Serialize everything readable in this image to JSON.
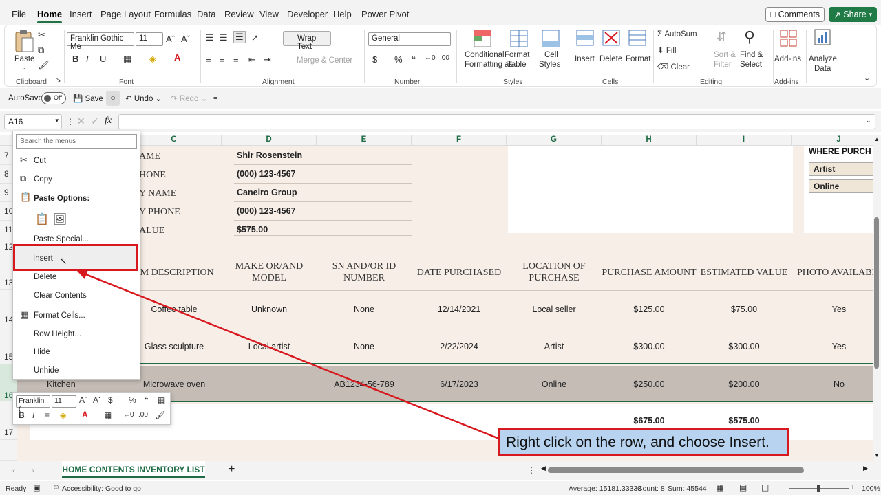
{
  "menu": {
    "tabs": [
      "File",
      "Home",
      "Insert",
      "Page Layout",
      "Formulas",
      "Data",
      "Review",
      "View",
      "Developer",
      "Help",
      "Power Pivot"
    ],
    "comments": "Comments",
    "share": "Share"
  },
  "ribbon": {
    "clipboard": {
      "paste": "Paste",
      "label": "Clipboard"
    },
    "font": {
      "name": "Franklin Gothic Me",
      "size": "11",
      "label": "Font"
    },
    "alignment": {
      "wrap": "Wrap Text",
      "merge": "Merge & Center",
      "label": "Alignment"
    },
    "number": {
      "format": "General",
      "label": "Number"
    },
    "styles": {
      "cond": "Conditional",
      "cond2": "Formatting",
      "fmt": "Format as",
      "fmt2": "Table",
      "cell": "Cell",
      "cell2": "Styles",
      "label": "Styles"
    },
    "cells": {
      "insert": "Insert",
      "delete": "Delete",
      "format": "Format",
      "label": "Cells"
    },
    "editing": {
      "autosum": "AutoSum",
      "fill": "Fill",
      "clear": "Clear",
      "sort": "Sort &",
      "sort2": "Filter",
      "find": "Find &",
      "find2": "Select",
      "label": "Editing"
    },
    "addins": {
      "addins": "Add-ins",
      "label": "Add-ins"
    },
    "analyze": {
      "l1": "Analyze",
      "l2": "Data"
    }
  },
  "qat": {
    "autosave": "AutoSave",
    "off": "Off",
    "save": "Save",
    "undo": "Undo",
    "redo": "Redo"
  },
  "formula": {
    "namebox": "A16",
    "fx": "fx"
  },
  "columns": [
    "C",
    "D",
    "E",
    "F",
    "G",
    "H",
    "I",
    "J"
  ],
  "rows": [
    "7",
    "8",
    "9",
    "10",
    "11",
    "12",
    "13",
    "14",
    "15",
    "16",
    "17"
  ],
  "info": {
    "labels": [
      "AME",
      "HONE",
      "Y NAME",
      "Y PHONE",
      "ALUE"
    ],
    "values": [
      "Shir Rosenstein",
      "(000) 123-4567",
      "Caneiro Group",
      "(000) 123-4567",
      "$575.00"
    ],
    "where_title": "WHERE PURCH",
    "where_items": [
      "Artist",
      "Online"
    ]
  },
  "table": {
    "headers": [
      "EM DESCRIPTION",
      "MAKE OR/AND MODEL",
      "SN AND/OR ID NUMBER",
      "DATE PURCHASED",
      "LOCATION OF PURCHASE",
      "PURCHASE AMOUNT",
      "ESTIMATED VALUE",
      "PHOTO AVAILABI"
    ],
    "rows": [
      [
        "",
        "Coffee table",
        "Unknown",
        "None",
        "12/14/2021",
        "Local seller",
        "$125.00",
        "$75.00",
        "Yes"
      ],
      [
        "",
        "Glass sculpture",
        "Local artist",
        "None",
        "2/22/2024",
        "Artist",
        "$300.00",
        "$300.00",
        "Yes"
      ],
      [
        "Kitchen",
        "Microwave oven",
        "",
        "AB1234-56-789",
        "6/17/2023",
        "Online",
        "$250.00",
        "$200.00",
        "No"
      ]
    ],
    "totals": [
      "$675.00",
      "$575.00"
    ]
  },
  "context_menu": {
    "search_placeholder": "Search the menus",
    "cut": "Cut",
    "copy": "Copy",
    "paste_options": "Paste Options:",
    "paste_special": "Paste Special...",
    "insert": "Insert",
    "delete": "Delete",
    "clear": "Clear Contents",
    "format_cells": "Format Cells...",
    "row_height": "Row Height...",
    "hide": "Hide",
    "unhide": "Unhide"
  },
  "mini": {
    "font": "Franklin (",
    "size": "11"
  },
  "callout": "Right click on the row, and choose Insert.",
  "sheet": {
    "tab": "HOME CONTENTS INVENTORY LIST"
  },
  "status": {
    "ready": "Ready",
    "accessibility": "Accessibility: Good to go",
    "average": "Average: 15181.33333",
    "count": "Count: 8",
    "sum": "Sum: 45544",
    "zoom": "100%"
  },
  "colors": {
    "accent": "#217346",
    "highlight": "#d7191f",
    "callout_bg": "#b7d3f0"
  }
}
